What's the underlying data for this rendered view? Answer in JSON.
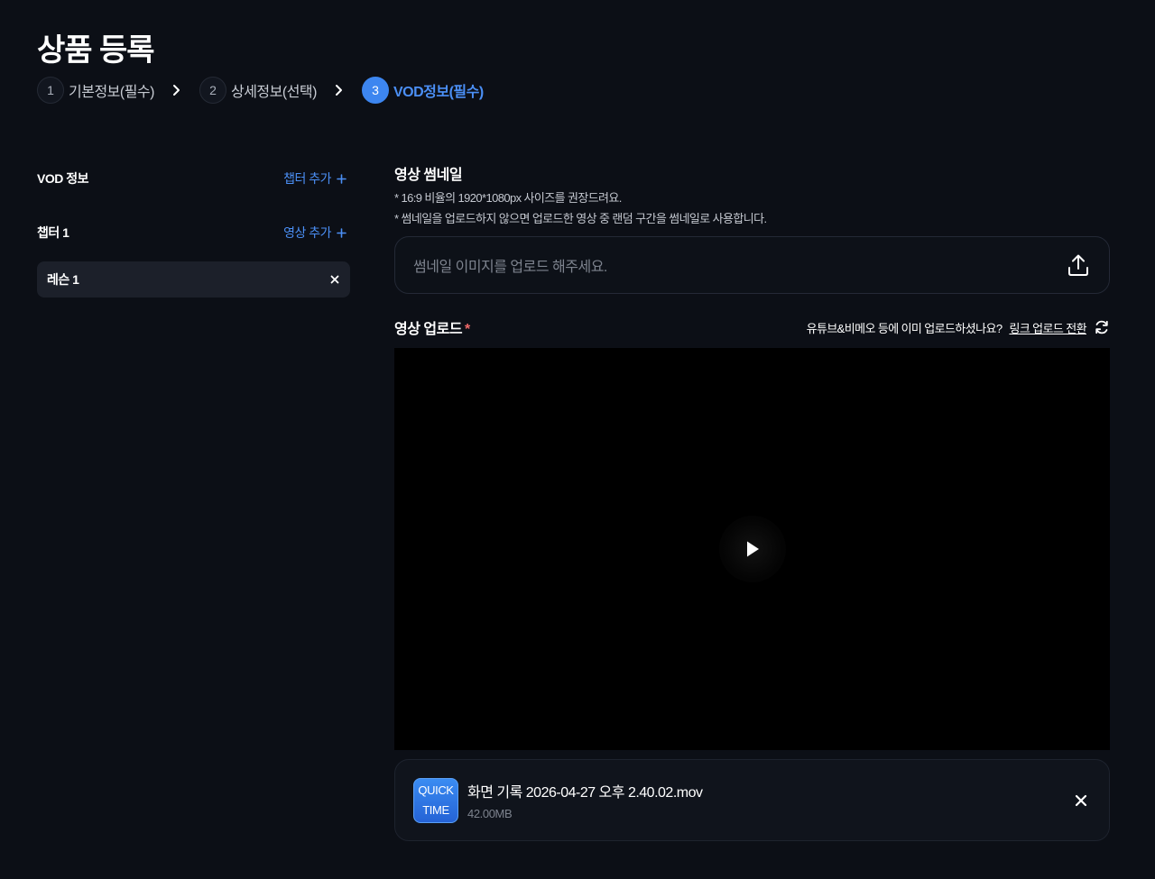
{
  "page": {
    "title": "상품 등록"
  },
  "steps": [
    {
      "num": "1",
      "label": "기본정보(필수)",
      "active": false
    },
    {
      "num": "2",
      "label": "상세정보(선택)",
      "active": false
    },
    {
      "num": "3",
      "label": "VOD정보(필수)",
      "active": true
    }
  ],
  "left": {
    "vod_title": "VOD 정보",
    "add_chapter": "챕터 추가",
    "chapter_title": "챕터 1",
    "add_video": "영상 추가",
    "lesson_label": "레슨 1"
  },
  "thumbnail": {
    "title": "영상 썸네일",
    "note1": "* 16:9 비율의 1920*1080px 사이즈를 권장드려요.",
    "note2": "* 썸네일을 업로드하지 않으면 업로드한 영상 중 랜덤 구간을 썸네일로 사용합니다.",
    "placeholder": "썸네일 이미지를 업로드 해주세요."
  },
  "video_upload": {
    "title": "영상 업로드",
    "required_mark": "*",
    "question": "유튜브&비메오 등에 이미 업로드하셨나요?",
    "link_switch": "링크 업로드 전환"
  },
  "file": {
    "icon_line1": "QUICK",
    "icon_line2": "TIME",
    "name": "화면 기록 2026-04-27 오후 2.40.02.mov",
    "size": "42.00MB"
  },
  "colors": {
    "background": "#0c0f16",
    "accent": "#3d86f0",
    "link": "#4b8ff5",
    "required": "#f06a6a"
  }
}
